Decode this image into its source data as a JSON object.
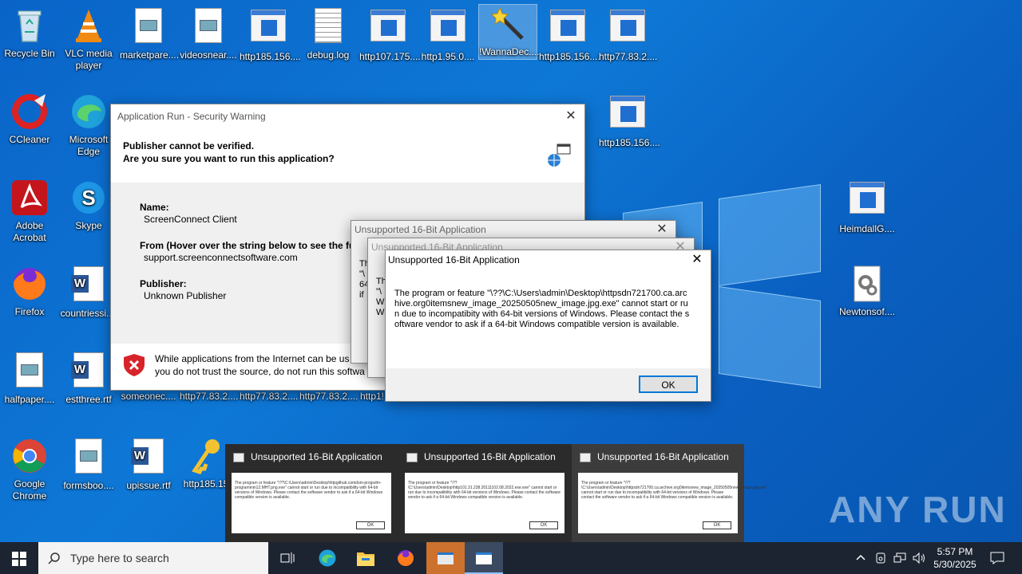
{
  "desktop_icons": [
    {
      "label": "Recycle Bin"
    },
    {
      "label": "VLC media player"
    },
    {
      "label": "marketpare...."
    },
    {
      "label": "videosnear...."
    },
    {
      "label": "http185.156...."
    },
    {
      "label": "debug.log"
    },
    {
      "label": "http107.175...."
    },
    {
      "label": "http1.95.0...."
    },
    {
      "label": "!WannaDec...."
    },
    {
      "label": "http185.156...."
    },
    {
      "label": "http77.83.2...."
    },
    {
      "label": "CCleaner"
    },
    {
      "label": "Microsoft Edge"
    },
    {
      "label": "http185.156...."
    },
    {
      "label": "Adobe Acrobat"
    },
    {
      "label": "Skype"
    },
    {
      "label": "HeimdallG...."
    },
    {
      "label": "Firefox"
    },
    {
      "label": "countriessi...."
    },
    {
      "label": "Newtonsof...."
    },
    {
      "label": "halfpaper...."
    },
    {
      "label": "estthree.rtf"
    },
    {
      "label": "someonec...."
    },
    {
      "label": "http77.83.2...."
    },
    {
      "label": "http77.83.2...."
    },
    {
      "label": "http77.83.2...."
    },
    {
      "label": "http1!"
    },
    {
      "label": "Google Chrome"
    },
    {
      "label": "formsboo...."
    },
    {
      "label": "upissue.rtf"
    },
    {
      "label": "http185.15"
    }
  ],
  "security_dialog": {
    "title": "Application Run - Security Warning",
    "heading1": "Publisher cannot be verified.",
    "heading2": "Are you sure you want to run this application?",
    "name_label": "Name:",
    "name_value": "ScreenConnect Client",
    "from_label": "From (Hover over the string below to see the fu",
    "from_value": "support.screenconnectsoftware.com",
    "publisher_label": "Publisher:",
    "publisher_value": "Unknown Publisher",
    "warning_line1": "While applications from the Internet can be us",
    "warning_line2": "you do not trust the source, do not run this softwa"
  },
  "bg_dialog1": {
    "title": "Unsupported 16-Bit Application",
    "partial": "Th \"\\ ai 64 if"
  },
  "bg_dialog2": {
    "title": "Unsupported 16-Bit Application",
    "partial": "Th \"\\ W W"
  },
  "main_dialog": {
    "title": "Unsupported 16-Bit Application",
    "message": "The program or feature \"\\??\\C:\\Users\\admin\\Desktop\\httpsdn721700.ca.archive.org0itemsnew_image_20250505new_image.jpg.exe\" cannot start or run due to incompatibity with 64-bit versions of Windows. Please contact the software vendor to ask if a 64-bit Windows compatible version is available.",
    "ok_label": "OK"
  },
  "thumbnails": [
    {
      "title": "Unsupported 16-Bit Application",
      "body": "The program or feature \"\\??\\C:\\Users\\admin\\Desktop\\httpgithub.comdsm-progsdm-programmin12.MHT.png.exe\" cannot start or run due to incompatibility with 64-bit versions of Windows. Please contact the software vendor to ask if a 64-bit Windows compatible version is available.",
      "ok": "OK"
    },
    {
      "title": "Unsupported 16-Bit Application",
      "body": "The program or feature \"\\??\\C:\\Users\\admin\\Desktop\\http101.31.238.20111102.08.2022.exe.exe\" cannot start or run due to incompatibility with 64-bit versions of Windows. Please contact the software vendor to ask if a 64-bit Windows compatible version is available.",
      "ok": "OK"
    },
    {
      "title": "Unsupported 16-Bit Application",
      "body": "The program or feature \"\\??\\C:\\Users\\admin\\Desktop\\httpsdn721700.ca.archive.org0itemsnew_image_20250505new_image.jpg.exe\" cannot start or run due to incompatibility with 64-bit versions of Windows. Please contact the software vendor to ask if a 64-bit Windows compatible version is available.",
      "ok": "OK"
    }
  ],
  "taskbar": {
    "search_placeholder": "Type here to search",
    "time": "5:57 PM",
    "date": "5/30/2025"
  },
  "watermark": "ANY RUN",
  "colors": {
    "accent": "#0a64c8",
    "taskbar": "#1c2431",
    "active_task": "#e07a2e"
  }
}
